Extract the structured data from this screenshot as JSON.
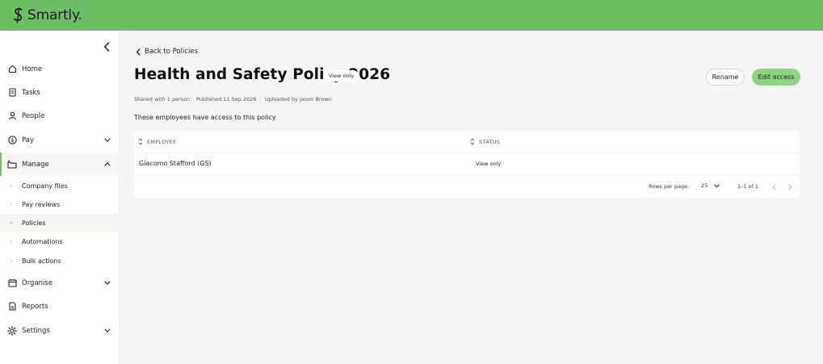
{
  "brand": {
    "name": "Smartly."
  },
  "sidebar": {
    "items": [
      {
        "key": "home",
        "label": "Home"
      },
      {
        "key": "tasks",
        "label": "Tasks"
      },
      {
        "key": "people",
        "label": "People"
      },
      {
        "key": "pay",
        "label": "Pay"
      },
      {
        "key": "manage",
        "label": "Manage"
      },
      {
        "key": "organise",
        "label": "Organise"
      },
      {
        "key": "reports",
        "label": "Reports"
      },
      {
        "key": "settings",
        "label": "Settings"
      }
    ],
    "manage_sub": [
      {
        "label": "Company files"
      },
      {
        "label": "Pay reviews"
      },
      {
        "label": "Policies"
      },
      {
        "label": "Automations"
      },
      {
        "label": "Bulk actions"
      }
    ]
  },
  "header": {
    "back_label": "Back to Policies",
    "title": "Health and Safety Policy 2026",
    "badge": "View only",
    "rename_label": "Rename",
    "edit_access_label": "Edit access",
    "shared_with": "Shared with 1 person",
    "published": "Published 11 Sep 2026",
    "uploaded_by": "Uploaded by Jason Brown"
  },
  "access": {
    "heading": "These employees have access to this policy",
    "columns": [
      "EMPLOYEE",
      "STATUS"
    ],
    "rows": [
      {
        "employee": "Giacomo Stafford (GS)",
        "status": "View only"
      }
    ],
    "rows_per_page_label": "Rows per page:",
    "rows_per_page_value": "25",
    "range": "1–1 of 1"
  },
  "colors": {
    "brand_green": "#6cbf63",
    "button_green": "#8fd286"
  }
}
